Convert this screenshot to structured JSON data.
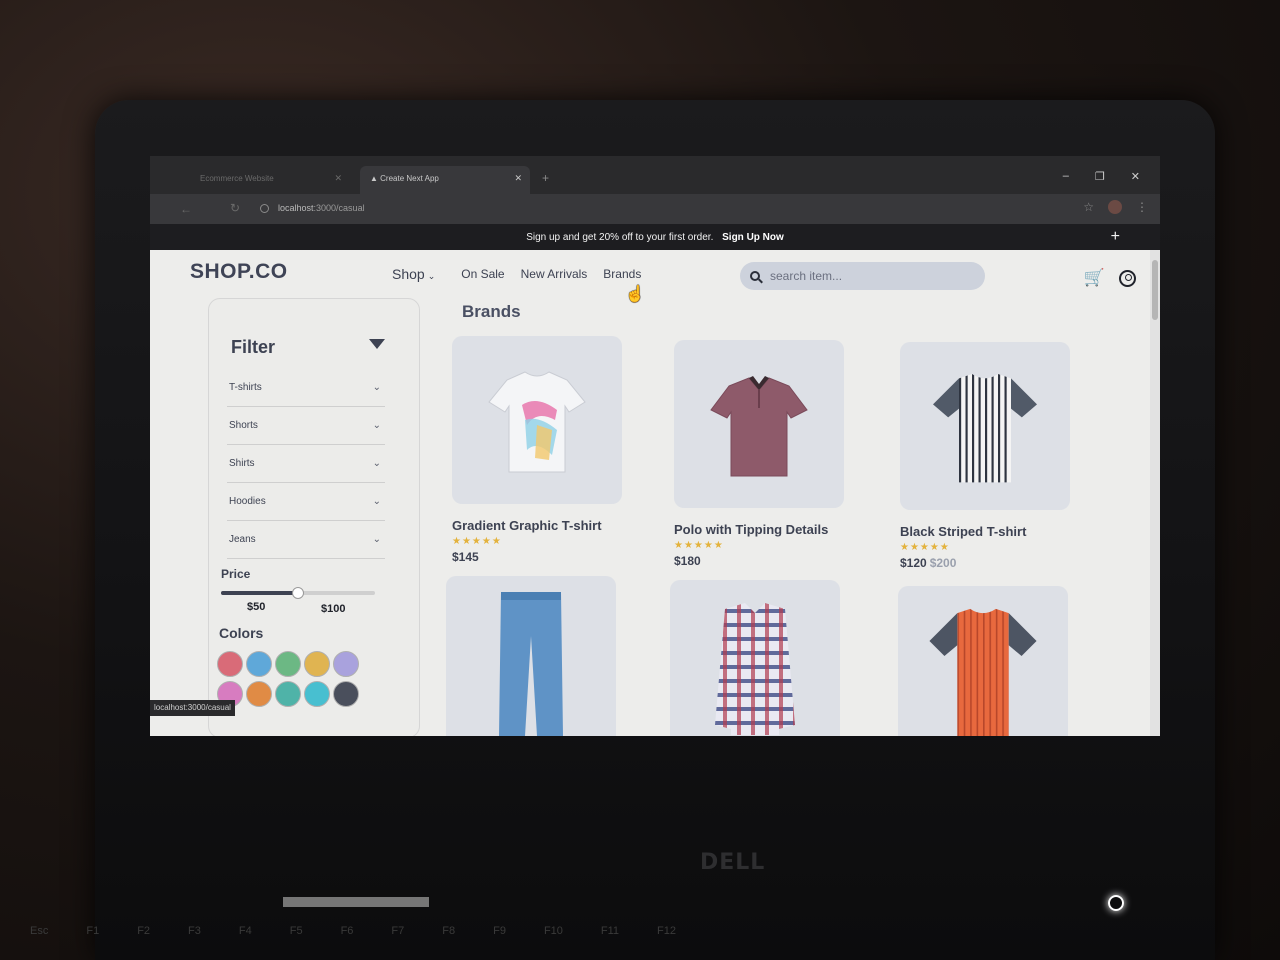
{
  "browser": {
    "tabs": [
      {
        "label": "Ecommerce Website",
        "active": false
      },
      {
        "label": "Create Next App",
        "active": true
      }
    ],
    "url_host": "localhost",
    "url_path": ":3000/casual",
    "status_url": "localhost:3000/casual",
    "window_controls": {
      "minimize": "–",
      "restore": "❐",
      "close": "✕"
    }
  },
  "promo": {
    "text": "Sign up and get 20% off to your first order.",
    "cta": "Sign Up Now",
    "plus": "+"
  },
  "header": {
    "logo": "SHOP.CO",
    "nav": {
      "shop": "Shop",
      "caret": "⌄",
      "links": [
        "On Sale",
        "New Arrivals",
        "Brands"
      ]
    },
    "search_placeholder": "search item...",
    "cart_icon": "🛒"
  },
  "sidebar": {
    "title": "Filter",
    "categories": [
      "T-shirts",
      "Shorts",
      "Shirts",
      "Hoodies",
      "Jeans"
    ],
    "chevron": "⌄",
    "price_title": "Price",
    "price_min": "$50",
    "price_max": "$100",
    "price_range_fraction": [
      0,
      0.5
    ],
    "colors_title": "Colors",
    "colors": [
      "#d96b78",
      "#5fa8d9",
      "#6cb884",
      "#e0b451",
      "#a9a2dd",
      "#d77cc0",
      "#e08b45",
      "#4fb3a8",
      "#48bfd0",
      "#4a4f5c"
    ]
  },
  "main": {
    "section_title": "Brands",
    "products": [
      {
        "name": "Gradient Graphic T-shirt",
        "stars": "★★★★★",
        "price": "$145",
        "old_price": ""
      },
      {
        "name": "Polo with Tipping Details",
        "stars": "★★★★★",
        "price": "$180",
        "old_price": ""
      },
      {
        "name": "Black Striped T-shirt",
        "stars": "★★★★★",
        "price": "$120",
        "old_price": "$200"
      },
      {
        "name": "",
        "stars": "",
        "price": "",
        "old_price": ""
      },
      {
        "name": "",
        "stars": "",
        "price": "",
        "old_price": ""
      },
      {
        "name": "",
        "stars": "",
        "price": "",
        "old_price": ""
      }
    ]
  },
  "hardware": {
    "brand": "DELL",
    "fkeys": [
      "Esc",
      "F1",
      "F2",
      "F3",
      "F4",
      "F5",
      "F6",
      "F7",
      "F8",
      "F9",
      "F10",
      "F11",
      "F12"
    ]
  }
}
